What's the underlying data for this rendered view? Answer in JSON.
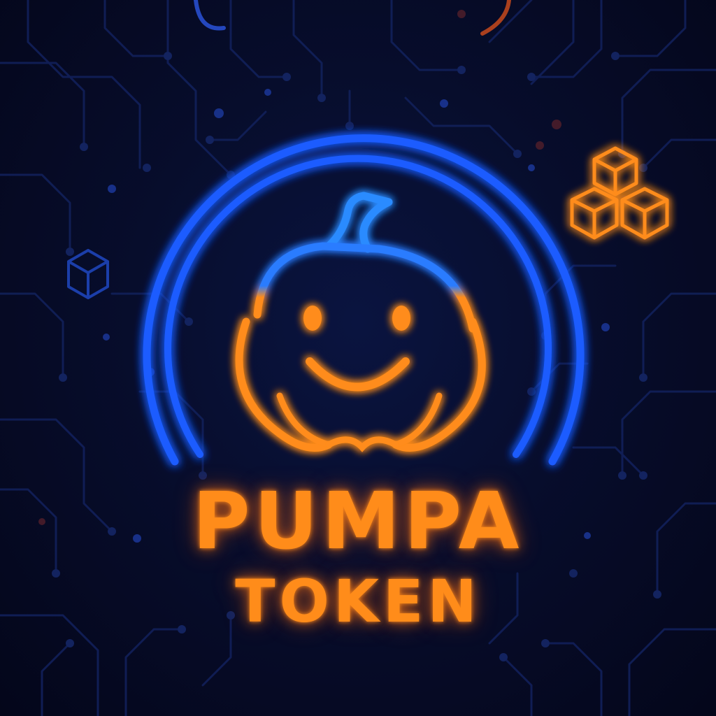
{
  "logo": {
    "title": "PUMPA",
    "subtitle": "TOKEN",
    "icon": "pumpkin-icon",
    "accent_orange": "#ff8c1a",
    "accent_blue": "#1f5cff"
  },
  "decor": {
    "large_cubes_icon": "cubes-icon",
    "small_cube_icon": "cube-icon",
    "background": "circuit-board-pattern"
  }
}
